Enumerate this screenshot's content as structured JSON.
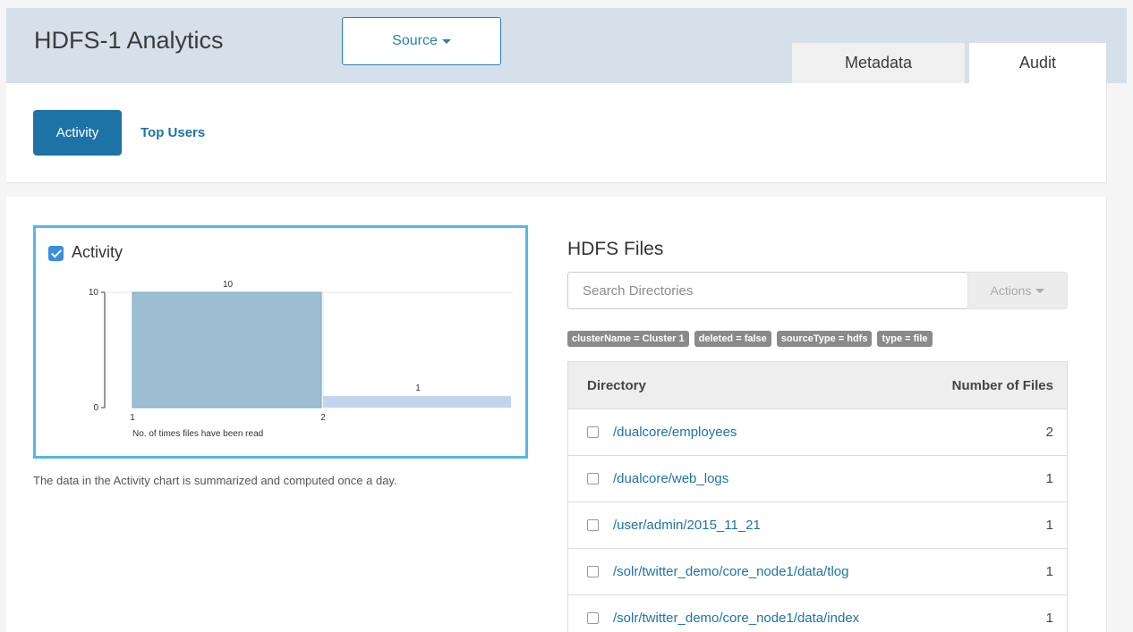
{
  "header": {
    "title": "HDFS-1 Analytics",
    "source_label": "Source",
    "tabs": [
      {
        "label": "Metadata"
      },
      {
        "label": "Audit"
      }
    ]
  },
  "subnav": {
    "items": [
      {
        "label": "Activity",
        "active": true
      },
      {
        "label": "Top Users",
        "active": false
      }
    ]
  },
  "activity": {
    "checkbox_label": "Activity",
    "note": "The data in the Activity chart is summarized and computed once a day."
  },
  "chart_data": {
    "type": "bar",
    "title": "",
    "xlabel": "No. of times files have been read",
    "ylabel": "",
    "x_ticks": [
      "1",
      "2"
    ],
    "y_ticks": [
      "0",
      "10"
    ],
    "ylim": [
      0,
      10
    ],
    "bins": [
      {
        "x_start": 1,
        "x_end": 2,
        "value": 10
      },
      {
        "x_start": 2,
        "x_end": 3,
        "value": 1
      }
    ],
    "colors": [
      "#9dbdd3",
      "#c2d5ef"
    ]
  },
  "files": {
    "title": "HDFS Files",
    "search_placeholder": "Search Directories",
    "actions_label": "Actions",
    "filters": [
      "clusterName = Cluster 1",
      "deleted = false",
      "sourceType = hdfs",
      "type = file"
    ],
    "columns": [
      "Directory",
      "Number of Files"
    ],
    "rows": [
      {
        "directory": "/dualcore/employees",
        "count": "2"
      },
      {
        "directory": "/dualcore/web_logs",
        "count": "1"
      },
      {
        "directory": "/user/admin/2015_11_21",
        "count": "1"
      },
      {
        "directory": "/solr/twitter_demo/core_node1/data/tlog",
        "count": "1"
      },
      {
        "directory": "/solr/twitter_demo/core_node1/data/index",
        "count": "1"
      }
    ]
  }
}
